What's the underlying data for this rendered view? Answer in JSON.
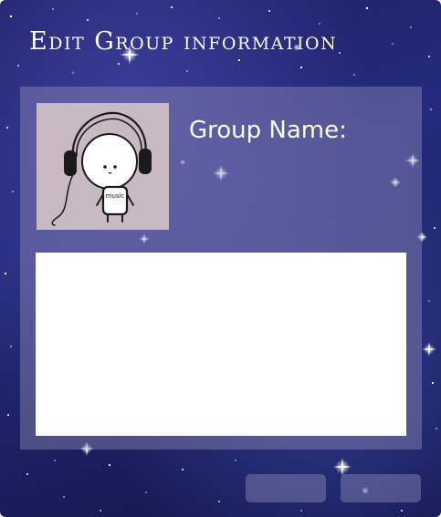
{
  "window": {
    "title": "Edit Group information"
  },
  "group": {
    "avatar_icon": "headphones-character-icon",
    "avatar_shirt_text": "music",
    "name_label": "Group Name:",
    "description_value": ""
  },
  "buttons": {
    "left_label": "",
    "right_label": ""
  },
  "colors": {
    "background": "#232878",
    "panel": "#8a87b0",
    "avatar_bg": "#c9b9c2",
    "text": "#ffffff"
  }
}
